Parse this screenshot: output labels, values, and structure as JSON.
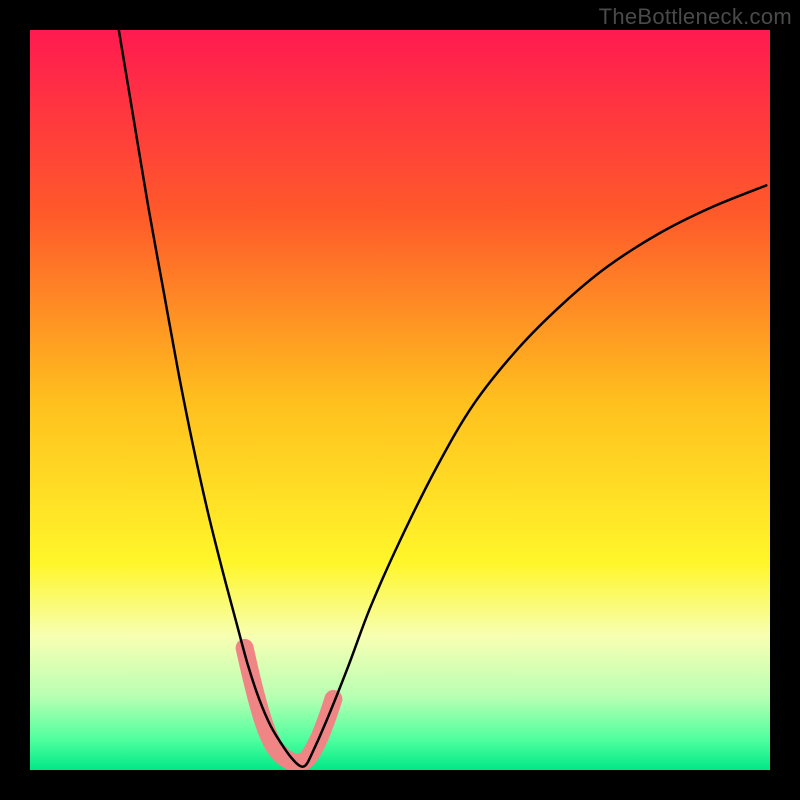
{
  "watermark": "TheBottleneck.com",
  "chart_data": {
    "type": "line",
    "title": "",
    "xlabel": "",
    "ylabel": "",
    "xlim": [
      0,
      100
    ],
    "ylim": [
      0,
      100
    ],
    "background_gradient": {
      "stops": [
        {
          "offset": 0,
          "color": "#ff1a50"
        },
        {
          "offset": 0.25,
          "color": "#ff5a2a"
        },
        {
          "offset": 0.5,
          "color": "#ffbf1e"
        },
        {
          "offset": 0.72,
          "color": "#fff62a"
        },
        {
          "offset": 0.82,
          "color": "#f7ffb3"
        },
        {
          "offset": 0.9,
          "color": "#b9ffb3"
        },
        {
          "offset": 0.96,
          "color": "#4dff9e"
        },
        {
          "offset": 1.0,
          "color": "#00e887"
        }
      ]
    },
    "series": [
      {
        "name": "bottleneck-curve",
        "color": "#000000",
        "width": 2.5,
        "x": [
          12,
          14,
          16,
          18,
          20,
          22,
          24,
          26,
          28,
          29.5,
          31,
          32.5,
          34,
          35.2,
          36.4,
          37.2,
          38,
          40,
          43,
          46,
          50,
          55,
          60,
          66,
          72,
          78,
          85,
          92,
          99.5
        ],
        "y": [
          100,
          88,
          76,
          65,
          54,
          44,
          35,
          27,
          19.5,
          14,
          9.5,
          6,
          3.5,
          1.8,
          0.6,
          0.6,
          2,
          6.5,
          14,
          22,
          31,
          41,
          49.5,
          57,
          63,
          68,
          72.5,
          76,
          79
        ]
      }
    ],
    "highlight_segment": {
      "name": "bottom-dip",
      "color": "#f08585",
      "width": 18,
      "points": [
        {
          "x": 29.0,
          "y": 16.5
        },
        {
          "x": 29.8,
          "y": 13.0
        },
        {
          "x": 30.6,
          "y": 9.8
        },
        {
          "x": 31.4,
          "y": 7.0
        },
        {
          "x": 32.2,
          "y": 4.8
        },
        {
          "x": 33.0,
          "y": 3.2
        },
        {
          "x": 34.0,
          "y": 2.0
        },
        {
          "x": 35.0,
          "y": 1.3
        },
        {
          "x": 36.0,
          "y": 1.0
        },
        {
          "x": 37.2,
          "y": 1.3
        },
        {
          "x": 38.2,
          "y": 2.6
        },
        {
          "x": 39.2,
          "y": 4.6
        },
        {
          "x": 40.2,
          "y": 7.2
        },
        {
          "x": 41.0,
          "y": 9.6
        }
      ]
    }
  }
}
